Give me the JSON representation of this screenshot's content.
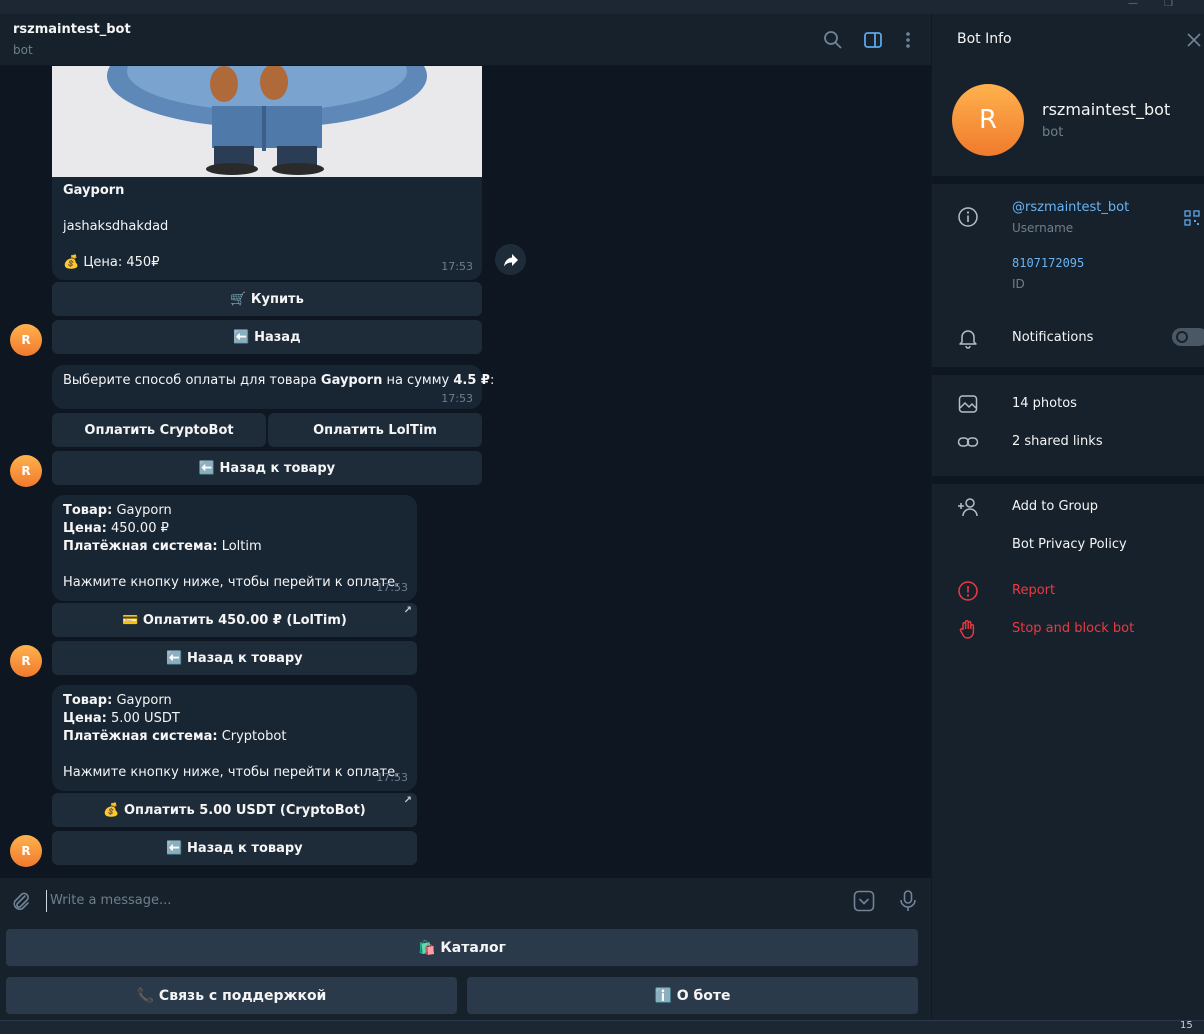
{
  "window": {
    "minimize": "—",
    "restore": "❐",
    "clock": "15"
  },
  "header": {
    "title": "rszmaintest_bot",
    "subtitle": "bot"
  },
  "messages": {
    "product": {
      "name": "Gayporn",
      "description": "jashaksdhakdad",
      "price": "💰 Цена: 450₽",
      "time": "17:53",
      "buttons": {
        "buy": "🛒 Купить",
        "back": "⬅️ Назад"
      }
    },
    "payment_choice": {
      "text_pre": "Выберите способ оплаты для товара ",
      "product": "Gayporn",
      "text_mid": " на сумму ",
      "amount": "4.5 ₽",
      "text_post": ":",
      "time": "17:53",
      "buttons": {
        "cryptobot": "Оплатить CryptoBot",
        "loltim": "Оплатить LolTim",
        "back": "⬅️ Назад к товару"
      }
    },
    "order_loltim": {
      "product_label": "Товар:",
      "product_value": " Gayporn",
      "price_label": "Цена:",
      "price_value": " 450.00 ₽",
      "system_label": "Платёжная система:",
      "system_value": " Loltim",
      "instruction": "Нажмите кнопку ниже, чтобы перейти к оплате.",
      "time": "17:53",
      "buttons": {
        "pay": "💳 Оплатить 450.00 ₽ (LolTim)",
        "back": "⬅️ Назад к товару"
      }
    },
    "order_crypto": {
      "product_label": "Товар:",
      "product_value": " Gayporn",
      "price_label": "Цена:",
      "price_value": " 5.00 USDT",
      "system_label": "Платёжная система:",
      "system_value": " Cryptobot",
      "instruction": "Нажмите кнопку ниже, чтобы перейти к оплате.",
      "time": "17:53",
      "buttons": {
        "pay": "💰 Оплатить 5.00 USDT (CryptoBot)",
        "back": "⬅️ Назад к товару"
      }
    },
    "avatar_letter": "R"
  },
  "composer": {
    "placeholder": "Write a message..."
  },
  "reply_keyboard": {
    "catalog": "🛍️ Каталог",
    "support": "📞 Связь с поддержкой",
    "about": "ℹ️ О боте"
  },
  "info": {
    "title": "Bot Info",
    "avatar_letter": "R",
    "name": "rszmaintest_bot",
    "subtitle": "bot",
    "username": "@rszmaintest_bot",
    "username_label": "Username",
    "id": "8107172095",
    "id_label": "ID",
    "notifications": "Notifications",
    "photos": "14 photos",
    "links": "2 shared links",
    "add_to_group": "Add to Group",
    "privacy": "Bot Privacy Policy",
    "report": "Report",
    "stop_block": "Stop and block bot"
  },
  "colors": {
    "bg": "#0e1621",
    "panel": "#17212b",
    "bubble": "#182533",
    "accent": "#6ab3f3",
    "danger": "#ec3942"
  }
}
